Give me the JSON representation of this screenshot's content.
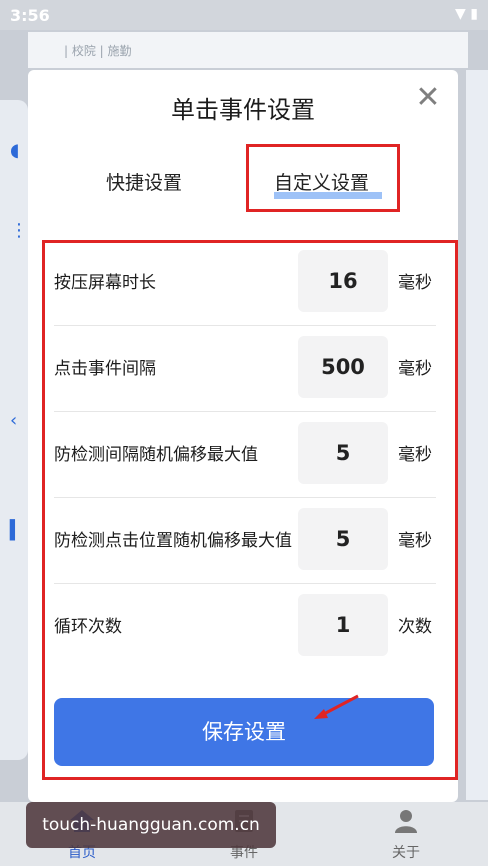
{
  "status_bar": {
    "time": "3:56"
  },
  "background": {
    "snippet": "| 校院 | 施勤"
  },
  "dialog": {
    "title": "单击事件设置",
    "tabs": [
      {
        "label": "快捷设置"
      },
      {
        "label": "自定义设置"
      }
    ],
    "rows": [
      {
        "label": "按压屏幕时长",
        "value": "16",
        "unit": "毫秒"
      },
      {
        "label": "点击事件间隔",
        "value": "500",
        "unit": "毫秒"
      },
      {
        "label": "防检测间隔随机偏移最大值",
        "value": "5",
        "unit": "毫秒"
      },
      {
        "label": "防检测点击位置随机偏移最大值",
        "value": "5",
        "unit": "毫秒"
      },
      {
        "label": "循环次数",
        "value": "1",
        "unit": "次数"
      }
    ],
    "save_label": "保存设置"
  },
  "bottom_nav": {
    "items": [
      {
        "label": "首页",
        "icon": "home-icon"
      },
      {
        "label": "事件",
        "icon": "document-icon"
      },
      {
        "label": "关于",
        "icon": "person-icon"
      }
    ]
  },
  "watermark": "touch-huangguan.com.cn",
  "colors": {
    "accent": "#3f76e6",
    "highlight": "#e02424"
  }
}
